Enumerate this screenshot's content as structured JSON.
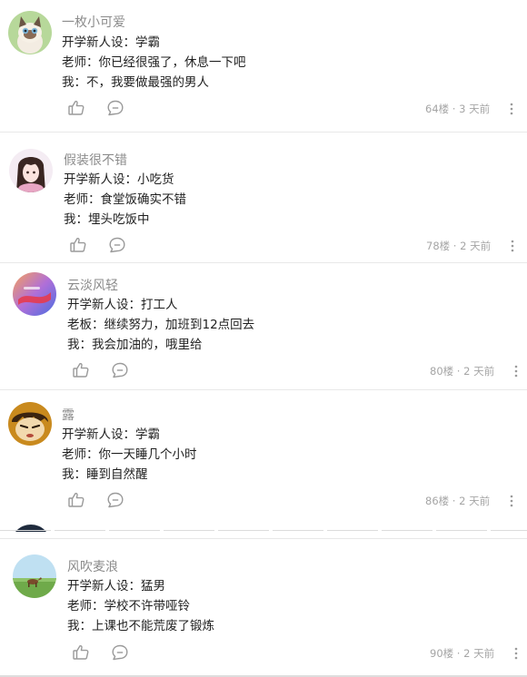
{
  "comments": [
    {
      "username": "一枚小可爱",
      "line1": "开学新人设：学霸",
      "line2": "老师：你已经很强了，休息一下吧",
      "line3": "我：不，我要做最强的男人",
      "floor": "64楼",
      "time": "3 天前",
      "avatar_icon": "cat-avatar"
    },
    {
      "username": "假装很不错",
      "line1": "开学新人设：小吃货",
      "line2": "老师：食堂饭确实不错",
      "line3": "我：埋头吃饭中",
      "floor": "78楼",
      "time": "2 天前",
      "avatar_icon": "anime-girl-avatar"
    },
    {
      "username": "云淡风轻",
      "line1": "开学新人设：打工人",
      "line2": "老板：继续努力，加班到12点回去",
      "line3": "我：我会加油的，哦里给",
      "floor": "80楼",
      "time": "2 天前",
      "avatar_icon": "gradient-abstract-avatar"
    },
    {
      "username": "露",
      "line1": "开学新人设：学霸",
      "line2": "老师：你一天睡几个小时",
      "line3": "我：睡到自然醒",
      "floor": "86楼",
      "time": "2 天前",
      "avatar_icon": "cartoon-boy-avatar"
    },
    {
      "username": "风吹麦浪",
      "line1": "开学新人设：猛男",
      "line2": "老师：学校不许带哑铃",
      "line3": "我：上课也不能荒废了锻炼",
      "floor": "90楼",
      "time": "2 天前",
      "avatar_icon": "landscape-horse-avatar"
    }
  ],
  "meta_separator": "·",
  "colors": {
    "username": "#8b8b8b",
    "text": "#1f1f1f",
    "meta": "#a5a5a5",
    "icon": "#9a9a9a",
    "divider": "#e8e8e8"
  }
}
